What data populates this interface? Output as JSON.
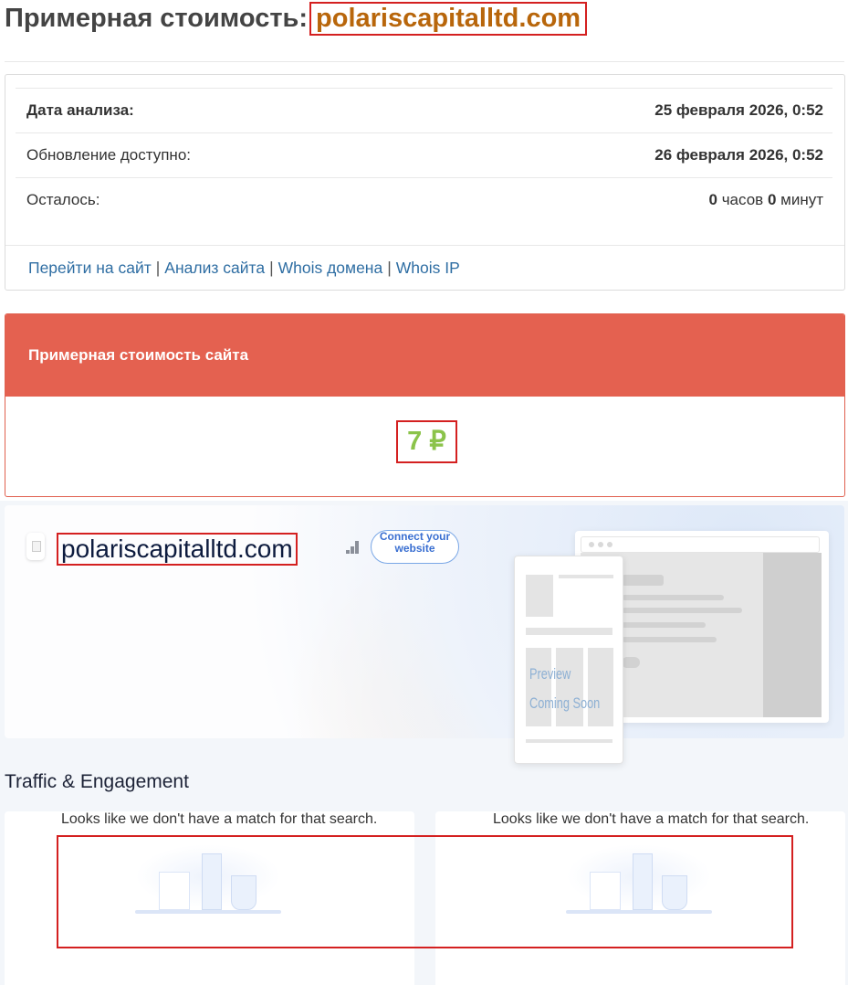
{
  "header": {
    "title_prefix": "Примерная стоимость:",
    "domain": "polariscapitalltd.com"
  },
  "info": {
    "rows": [
      {
        "label": "Дата анализа:",
        "value": "25 февраля 2026, 0:52"
      },
      {
        "label": "Обновление доступно:",
        "value": "26 февраля 2026, 0:52"
      },
      {
        "label": "Осталось:",
        "hours": "0",
        "hours_unit": "часов",
        "minutes": "0",
        "minutes_unit": "минут"
      }
    ],
    "links": [
      "Перейти на сайт",
      "Анализ сайта",
      "Whois домена",
      "Whois IP"
    ],
    "link_separator": "|"
  },
  "cost": {
    "heading": "Примерная стоимость сайта",
    "value": "7 ₽"
  },
  "preview": {
    "domain": "polariscapitalltd.com",
    "connect_button": "Connect your website",
    "placeholder_line1": "Preview",
    "placeholder_line2": "Coming Soon"
  },
  "traffic": {
    "section_title": "Traffic & Engagement",
    "empty_message_left": "Looks like we don't have a match for that search.",
    "empty_message_right": "Looks like we don't have a match for that search."
  },
  "colors": {
    "accent_red": "#e46150",
    "highlight_border": "#d42020",
    "domain_orange": "#b8660b",
    "cost_green": "#8bc34a",
    "link_blue": "#2f6ea3"
  }
}
